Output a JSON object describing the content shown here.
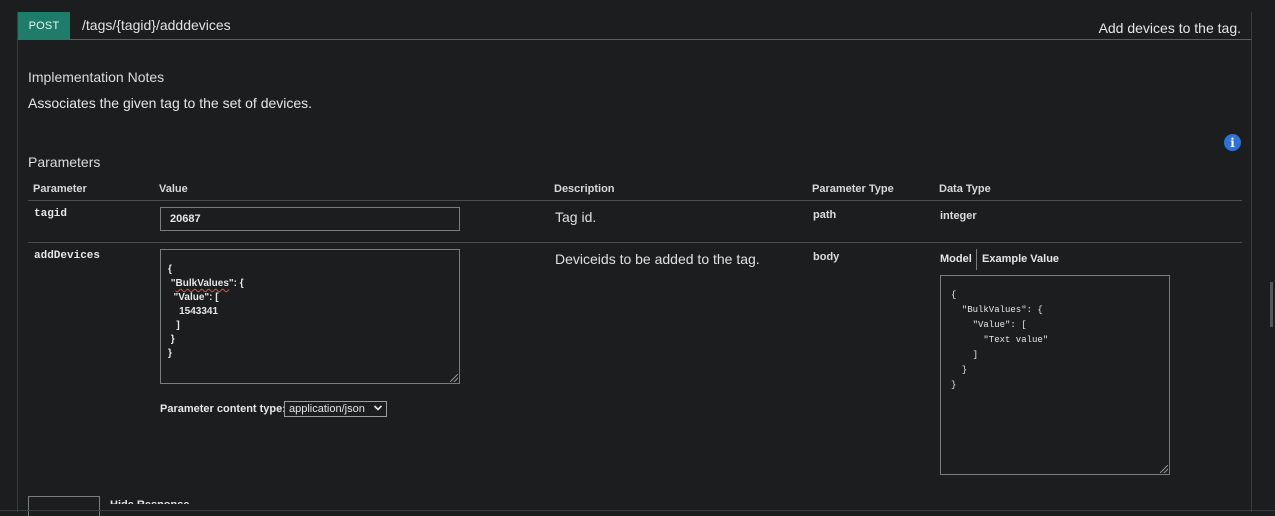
{
  "operation": {
    "method": "POST",
    "path": "/tags/{tagid}/adddevices",
    "summary": "Add devices to the tag."
  },
  "implementation_notes": {
    "title": "Implementation Notes",
    "text": "Associates the given tag to the set of devices."
  },
  "parameters": {
    "title": "Parameters",
    "headers": {
      "parameter": "Parameter",
      "value": "Value",
      "description": "Description",
      "parameter_type": "Parameter Type",
      "data_type": "Data Type"
    },
    "rows": [
      {
        "name": "tagid",
        "value": "20687",
        "description": "Tag id.",
        "parameter_type": "path",
        "data_type": "integer"
      },
      {
        "name": "addDevices",
        "body_lines": [
          "{",
          "  \"",
          "BulkValues",
          "\": {",
          "   \"Value\": [",
          "     1543341",
          "    ]",
          "  }",
          "}"
        ],
        "body_line1": "{",
        "body_line2_pre": " \"",
        "body_line2_key": "BulkValues",
        "body_line2_post": "\": {",
        "body_line3": "  \"Value\": [",
        "body_line4": "    1543341",
        "body_line5": "   ]",
        "body_line6": " }",
        "body_line7": "}",
        "description": "Deviceids to be added to the tag.",
        "parameter_type": "body",
        "content_type_label": "Parameter content type:",
        "content_type_selected": "application/json",
        "model_tab": "Model",
        "example_tab": "Example Value",
        "example_value": "{\n  \"BulkValues\": {\n    \"Value\": [\n      \"Text value\"\n    ]\n  }\n}"
      }
    ]
  },
  "footer": {
    "hide_response": "Hide Response"
  },
  "icons": {
    "info": "info-icon",
    "select": "chevron-down-icon"
  },
  "colors": {
    "method_badge": "#1e7d6a",
    "info_icon": "#2d72d9",
    "background": "#1b1d1f"
  }
}
